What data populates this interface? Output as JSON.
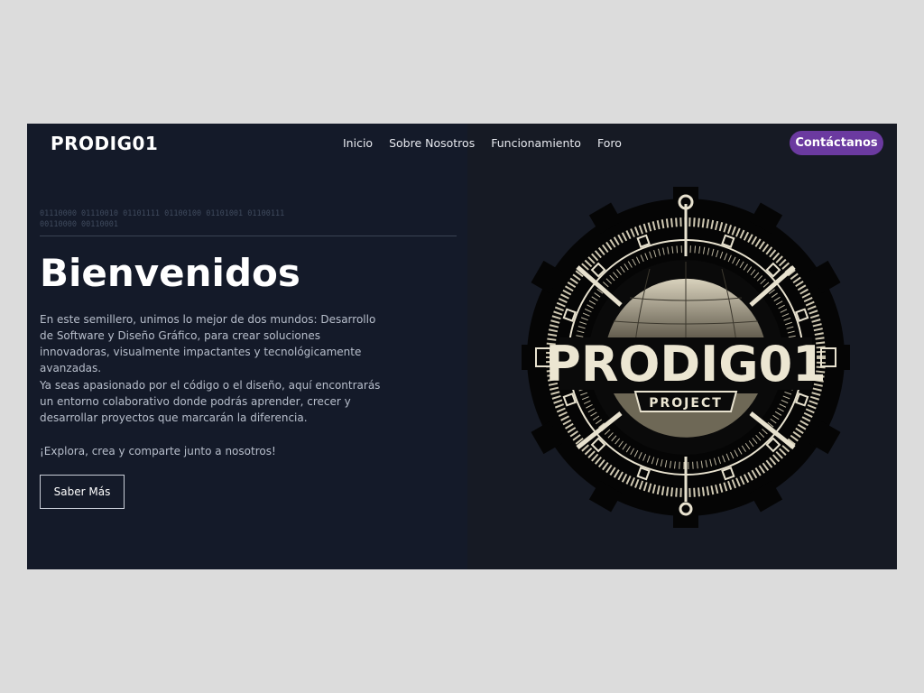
{
  "brand": "PRODIG01",
  "nav": [
    "Inicio",
    "Sobre Nosotros",
    "Funcionamiento",
    "Foro"
  ],
  "cta": "Contáctanos",
  "hero": {
    "binary": "01110000 01110010 01101111 01100100 01101001 01100111 00110000 00110001",
    "title": "Bienvenidos",
    "paragraphs": [
      "En este semillero, unimos lo mejor de dos mundos: Desarrollo de Software y Diseño Gráfico, para crear soluciones innovadoras, visualmente impactantes y tecnológicamente avanzadas.",
      "Ya seas apasionado por el código o el diseño, aquí encontrarás un entorno colaborativo donde podrás aprender, crecer y desarrollar proyectos que marcarán la diferencia.",
      "¡Explora, crea y comparte junto a nosotros!"
    ],
    "button": "Saber Más"
  },
  "logo": {
    "title": "PRODIG01",
    "subtitle": "PROJECT"
  },
  "colors": {
    "background": "#dcdcdc",
    "site": "#141a29",
    "accent": "#6b3aa0",
    "logo_cream": "#e8e2cf"
  }
}
